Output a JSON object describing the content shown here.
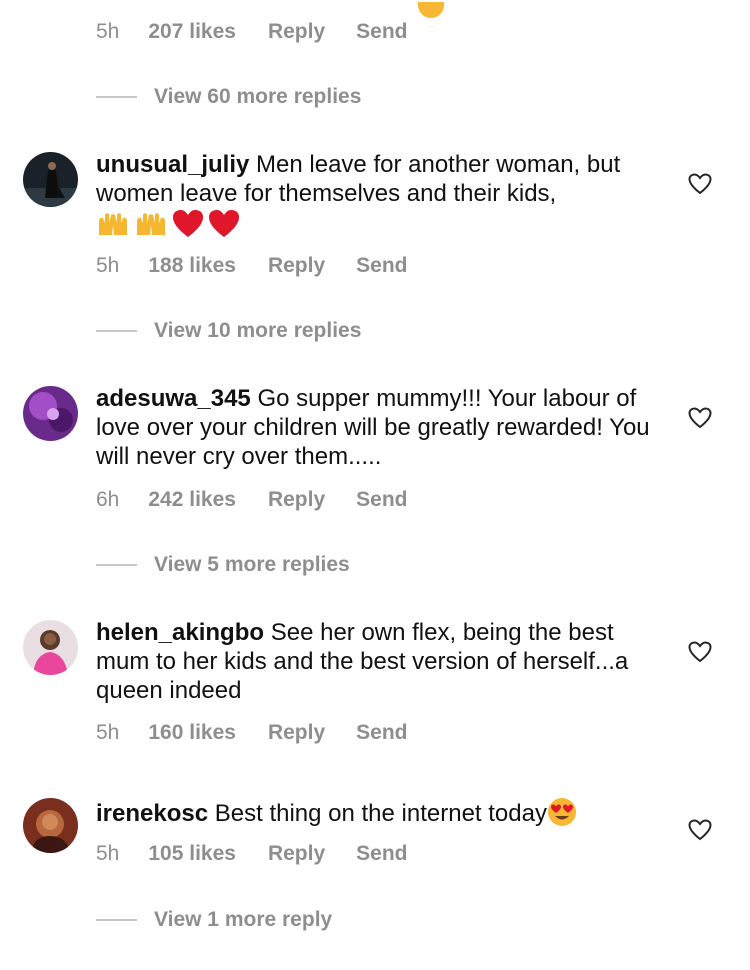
{
  "top": {
    "time": "5h",
    "likes": "207 likes",
    "reply": "Reply",
    "send": "Send",
    "view_replies": "View 60 more replies"
  },
  "comments": [
    {
      "username": "unusual_juliy",
      "text": "Men leave for another woman, but women leave for themselves and their kids,",
      "emojis": [
        "raising-hands",
        "raising-hands",
        "red-heart",
        "red-heart"
      ],
      "time": "5h",
      "likes": "188 likes",
      "reply": "Reply",
      "send": "Send",
      "view_replies": "View 10 more replies"
    },
    {
      "username": "adesuwa_345",
      "text": "Go supper mummy!!! Your labour of love over your children will be greatly rewarded! You will never cry over them.....",
      "time": "6h",
      "likes": "242 likes",
      "reply": "Reply",
      "send": "Send",
      "view_replies": "View 5 more replies"
    },
    {
      "username": "helen_akingbo",
      "text": "See her own flex, being the best mum to her kids and the best version of herself...a queen indeed",
      "time": "5h",
      "likes": "160 likes",
      "reply": "Reply",
      "send": "Send"
    },
    {
      "username": "irenekosc",
      "text": "Best thing on the internet today",
      "emojis": [
        "heart-eyes"
      ],
      "time": "5h",
      "likes": "105 likes",
      "reply": "Reply",
      "send": "Send",
      "view_replies": "View 1 more reply"
    }
  ],
  "colors": {
    "meta_gray": "#8e8e8e",
    "line_gray": "#c7c7c7",
    "text": "#111111",
    "heart_red": "#e0162b"
  }
}
